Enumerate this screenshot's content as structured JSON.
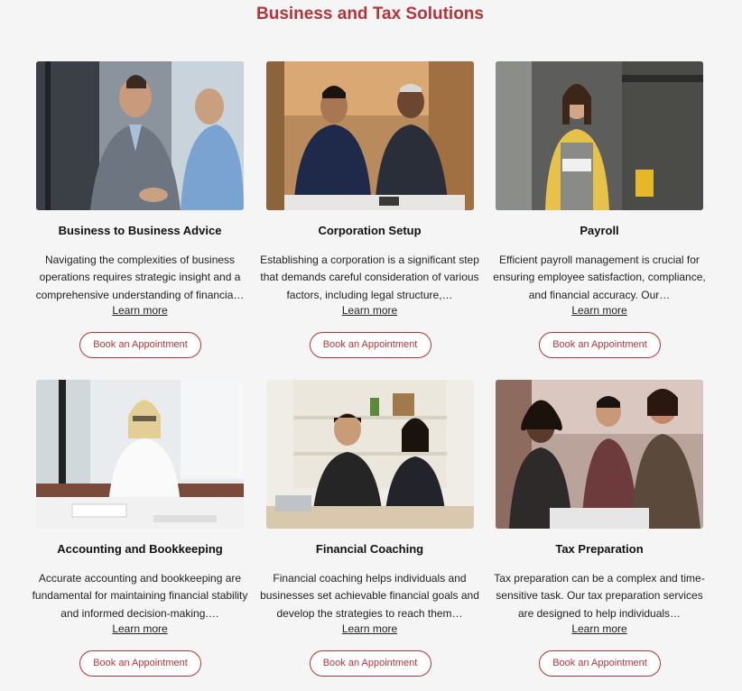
{
  "page_title": "Business and Tax Solutions",
  "accent_color": "#b5343a",
  "cards": [
    {
      "image_alt": "businessmen-shaking-hands-image",
      "title": "Business to Business Advice",
      "description": "Navigating the complexities of business operations requires strategic insight and a comprehensive understanding of financia…",
      "link_label": "Learn more",
      "button_label": "Book an Appointment"
    },
    {
      "image_alt": "corporation-meeting-image",
      "title": "Corporation Setup",
      "description": "Establishing a corporation is a significant step that demands careful consideration of various factors, including legal structure,…",
      "link_label": "Learn more",
      "button_label": "Book an Appointment"
    },
    {
      "image_alt": "cafe-owner-with-tablet-image",
      "title": "Payroll",
      "description": "Efficient payroll management is crucial for ensuring employee satisfaction, compliance, and financial accuracy. Our…",
      "link_label": "Learn more",
      "button_label": "Book an Appointment"
    },
    {
      "image_alt": "woman-on-phone-writing-image",
      "title": "Accounting and Bookkeeping",
      "description": "Accurate accounting and bookkeeping are fundamental for maintaining financial stability and informed decision-making.…",
      "link_label": "Learn more",
      "button_label": "Book an Appointment"
    },
    {
      "image_alt": "couple-reviewing-finances-image",
      "title": "Financial Coaching",
      "description": "Financial coaching helps individuals and businesses set achievable financial goals and develop the strategies to reach them…",
      "link_label": "Learn more",
      "button_label": "Book an Appointment"
    },
    {
      "image_alt": "team-tax-meeting-image",
      "title": "Tax Preparation",
      "description": "Tax preparation can be a complex and time-sensitive task. Our tax preparation services are designed to help individuals…",
      "link_label": "Learn more",
      "button_label": "Book an Appointment"
    }
  ]
}
